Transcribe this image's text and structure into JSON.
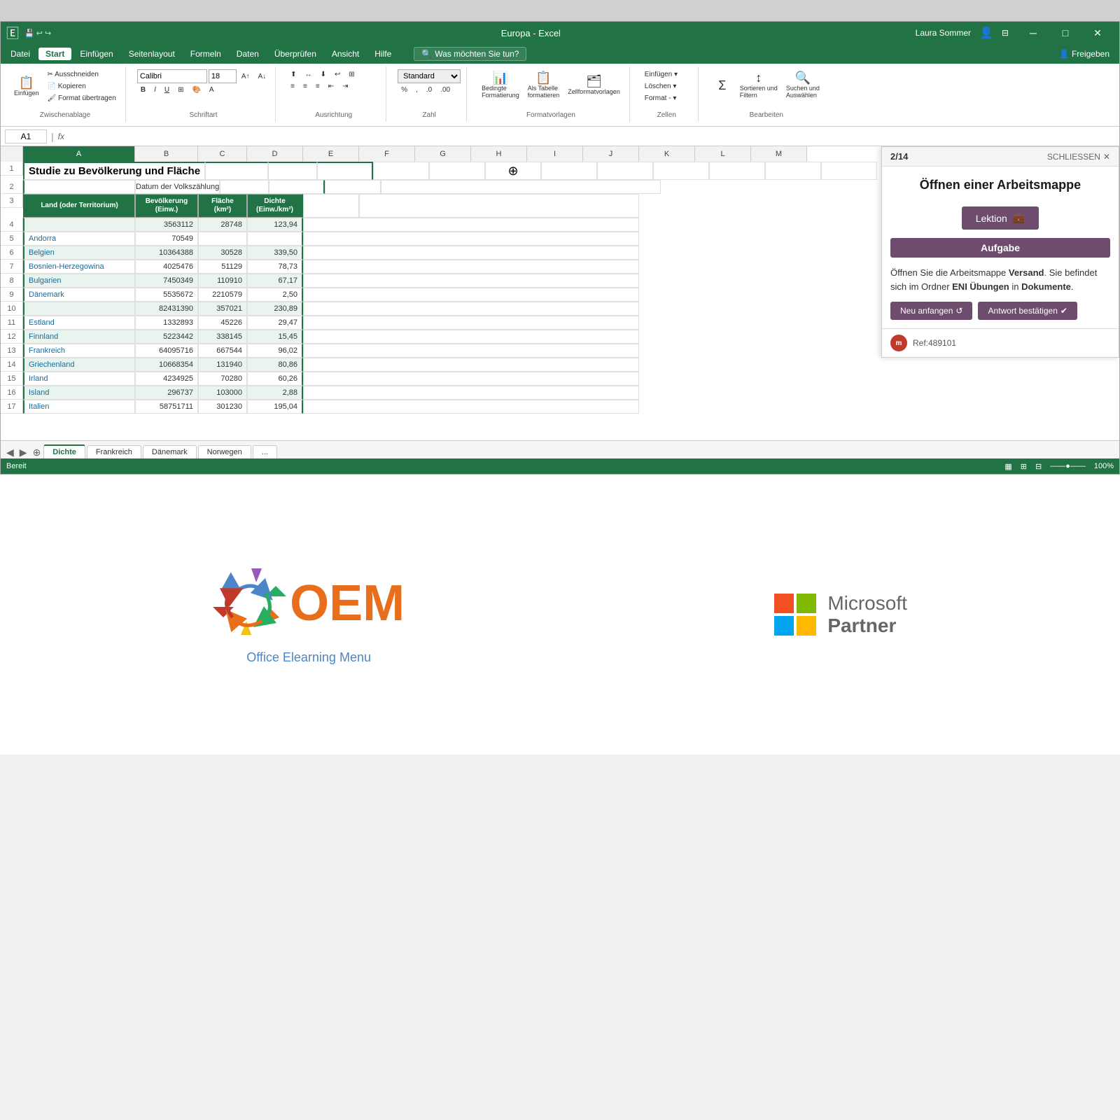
{
  "window": {
    "title": "Europa - Excel",
    "user": "Laura Sommer",
    "status": "Bereit"
  },
  "menu": {
    "items": [
      "Datei",
      "Start",
      "Einfügen",
      "Seitenlayout",
      "Formeln",
      "Daten",
      "Überprüfen",
      "Ansicht",
      "Hilfe"
    ],
    "active": "Start",
    "search_placeholder": "Was möchten Sie tun?",
    "share": "Freigeben"
  },
  "ribbon": {
    "clipboard_label": "Zwischenablage",
    "font_label": "Schriftart",
    "alignment_label": "Ausrichtung",
    "number_label": "Zahl",
    "styles_label": "Formatvorlagen",
    "cells_label": "Zellen",
    "editing_label": "Bearbeiten",
    "font_name": "Calibri",
    "font_size": "18",
    "buttons": {
      "einfuegen": "Einfügen",
      "bedingte": "Bedingte\nFormatierung",
      "als_tabelle": "Als Tabelle\nformatieren",
      "zellformatvorlagen": "Zellenformatvorlagen",
      "einfuegen_cell": "Einfügen",
      "loeschen": "Löschen",
      "format": "Format",
      "sortieren": "Sortieren und\nFiltern",
      "suchen": "Suchen und\nAuswählen"
    }
  },
  "formula_bar": {
    "cell_ref": "A1",
    "formula": "Studie zu Bevölkerung und Fläche"
  },
  "spreadsheet": {
    "title": "Studie zu Bevölkerung und Fläche",
    "subtitle": "Datum der Volkszählung",
    "columns": [
      "A",
      "B",
      "C",
      "D",
      "E",
      "F",
      "G",
      "H",
      "I",
      "J",
      "K",
      "L",
      "M"
    ],
    "col_headers": [
      "Land (oder Territorium)",
      "Bevölkerung\n(Einw.)",
      "Fläche\n(km²)",
      "Dichte\n(Einw./km²)"
    ],
    "rows": [
      {
        "id": 4,
        "country": "",
        "pop": "3563112",
        "area": "28748",
        "density": "123,94"
      },
      {
        "id": 5,
        "country": "Andorra",
        "pop": "70549",
        "area": "",
        "density": ""
      },
      {
        "id": 6,
        "country": "Belgien",
        "pop": "10364388",
        "area": "30528",
        "density": "339,50"
      },
      {
        "id": 7,
        "country": "Bosnien-Herzegowina",
        "pop": "4025476",
        "area": "51129",
        "density": "78,73"
      },
      {
        "id": 8,
        "country": "Bulgarien",
        "pop": "7450349",
        "area": "110910",
        "density": "67,17"
      },
      {
        "id": 9,
        "country": "Dänemark",
        "pop": "5535672",
        "area": "2210579",
        "density": "2,50"
      },
      {
        "id": 10,
        "country": "",
        "pop": "82431390",
        "area": "357021",
        "density": "230,89"
      },
      {
        "id": 11,
        "country": "Estland",
        "pop": "1332893",
        "area": "45226",
        "density": "29,47"
      },
      {
        "id": 12,
        "country": "Finnland",
        "pop": "5223442",
        "area": "338145",
        "density": "15,45"
      },
      {
        "id": 13,
        "country": "Frankreich",
        "pop": "64095716",
        "area": "667544",
        "density": "96,02"
      },
      {
        "id": 14,
        "country": "Griechenland",
        "pop": "10668354",
        "area": "131940",
        "density": "80,86"
      },
      {
        "id": 15,
        "country": "Irland",
        "pop": "4234925",
        "area": "70280",
        "density": "60,26"
      },
      {
        "id": 16,
        "country": "Island",
        "pop": "296737",
        "area": "103000",
        "density": "2,88"
      },
      {
        "id": 17,
        "country": "Italien",
        "pop": "58751711",
        "area": "301230",
        "density": "195,04"
      }
    ]
  },
  "side_panel": {
    "nav": "2/14",
    "close_btn": "SCHLIESSEN",
    "title": "Öffnen einer Arbeitsmappe",
    "lesson_btn": "Lektion",
    "task_header": "Aufgabe",
    "task_text_1": "Öffnen Sie die Arbeitsmappe ",
    "task_bold_1": "Versand",
    "task_text_2": ". Sie befindet sich im Ordner ",
    "task_bold_2": "ENI Übungen",
    "task_text_3": " in ",
    "task_bold_3": "Dokumente",
    "task_text_4": ".",
    "restart_btn": "Neu anfangen",
    "confirm_btn": "Antwort bestätigen",
    "ref": "Ref:489101"
  },
  "sheet_tabs": [
    "Dichte",
    "Frankreich",
    "Dänemark",
    "Norwegen",
    "..."
  ],
  "status_bar": {
    "left": "Bereit",
    "zoom": "100%"
  },
  "bottom": {
    "oem_tagline": "Office Elearning Menu",
    "ms_microsoft": "Microsoft",
    "ms_partner": "Partner"
  }
}
